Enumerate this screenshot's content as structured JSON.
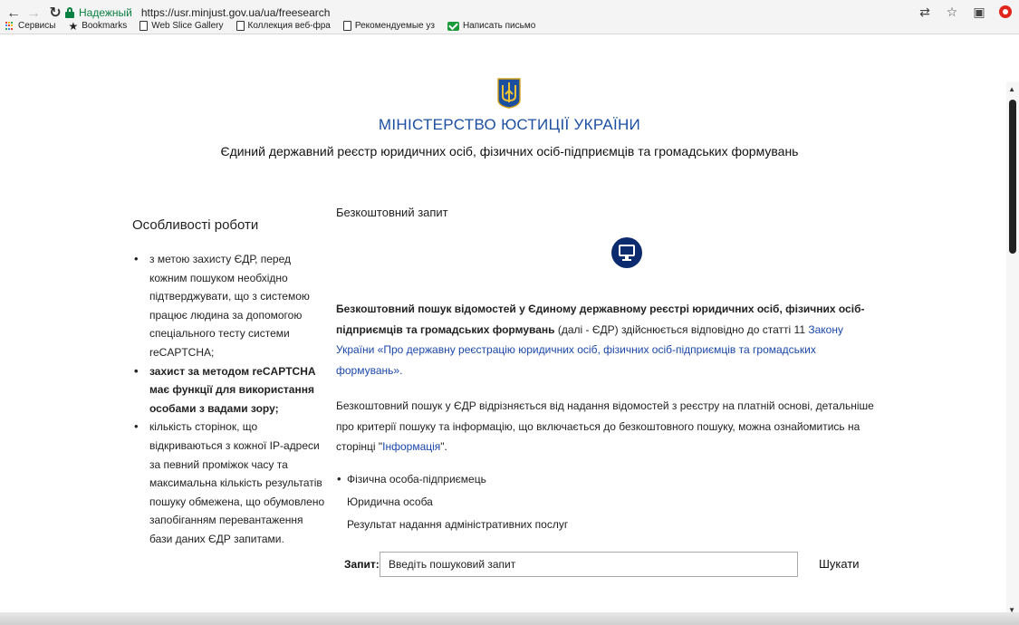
{
  "browser": {
    "nav": {
      "back_icon": "arrow-left-icon",
      "forward_icon": "arrow-right-icon",
      "reload_icon": "reload-icon"
    },
    "secure_label": "Надежный",
    "url": "https://usr.minjust.gov.ua/ua/freesearch",
    "bookmarks": [
      {
        "icon": "apps-grid-icon",
        "label": "Сервисы"
      },
      {
        "icon": "star-icon",
        "label": "Bookmarks"
      },
      {
        "icon": "page-icon",
        "label": "Web Slice Gallery"
      },
      {
        "icon": "page-icon",
        "label": "Коллекция веб-фра"
      },
      {
        "icon": "page-icon",
        "label": "Рекомендуемые уз"
      },
      {
        "icon": "mail-icon",
        "label": "Написать письмо"
      }
    ]
  },
  "header": {
    "ministry_title": "МІНІСТЕРСТВО ЮСТИЦІЇ УКРАЇНИ",
    "registry_title": "Єдиний державний реєстр юридичних осіб, фізичних осіб-підприємців та громадських формувань"
  },
  "sidebar": {
    "title": "Особливості роботи",
    "items": [
      {
        "text": "з метою захисту ЄДР, перед кожним пошуком необхідно підтверджувати, що з системою працює людина за допомогою спеціального тесту системи reCAPTCHA;",
        "bold": false
      },
      {
        "text": "захист за методом reCAPTCHA має функції для використання особами з вадами зору;",
        "bold": true
      },
      {
        "text": "кількість сторінок, що відкриваються з кожної IP-адреси за певний проміжок часу та максимальна кількість результатів пошуку обмежена, що обумовлено запобіганням перевантаження бази даних ЄДР запитами.",
        "bold": false
      }
    ]
  },
  "main": {
    "heading": "Безкоштовний запит",
    "para1_bold": "Безкоштовний пошук відомостей у Єдиному державному реєстрі юридичних осіб, фізичних осіб-підприємців та громадських формувань",
    "para1_text": " (далі - ЄДР) здійснюється відповідно до статті 11 ",
    "para1_link": "Закону України «Про державну реєстрацію юридичних осіб, фізичних осіб-підприємців та громадських формувань».",
    "para2_text": "Безкоштовний пошук у ЄДР відрізняється від надання відомостей з реєстру на платній основі, детальніше про критерії пошуку та інформацію, що включається до безкоштовного пошуку, можна ознайомитись на сторінці \"",
    "para2_link": "Інформація",
    "para2_end": "\".",
    "search_types": [
      {
        "label": "Фізична особа-підприємець",
        "active": true
      },
      {
        "label": "Юридична особа",
        "active": false
      },
      {
        "label": "Результат надання адміністративних послуг",
        "active": false
      }
    ],
    "query_label": "Запит:",
    "query_placeholder": "Введіть пошуковий запит",
    "search_button": "Шукати"
  },
  "colors": {
    "ministry_blue": "#1c4fa0",
    "link_blue": "#1a47a8",
    "secure_green": "#0b8043",
    "icon_navy": "#0c2a6e"
  }
}
